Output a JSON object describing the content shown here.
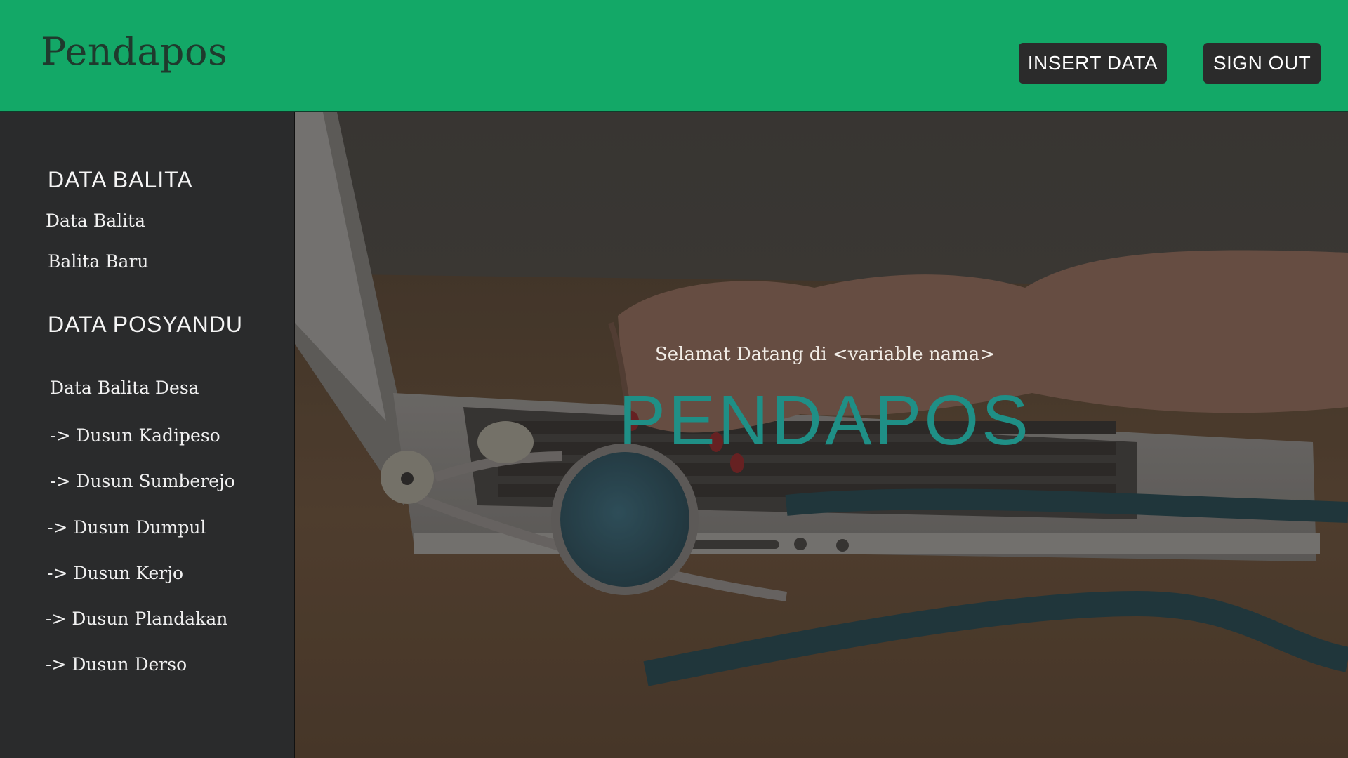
{
  "header": {
    "brand": "Pendapos",
    "insert_label": "INSERT DATA",
    "signout_label": "SIGN OUT"
  },
  "sidebar": {
    "section1_heading": "DATA BALITA",
    "section1_items": [
      "Data Balita",
      "Balita Baru"
    ],
    "section2_heading": "DATA POSYANDU",
    "section2_items": [
      "Data Balita Desa",
      "-> Dusun Kadipeso",
      "-> Dusun Sumberejo",
      "-> Dusun Dumpul",
      "-> Dusun Kerjo",
      "-> Dusun Plandakan",
      "-> Dusun Derso"
    ]
  },
  "hero": {
    "welcome": "Selamat Datang di <variable nama>",
    "title": "PENDAPOS"
  },
  "colors": {
    "header_bg": "#13a867",
    "sidebar_bg": "#2a2b2c",
    "button_bg": "#2b2b2b",
    "title_accent": "#1f8f86"
  },
  "icons": {
    "hero_image": "laptop-stethoscope-photo"
  }
}
